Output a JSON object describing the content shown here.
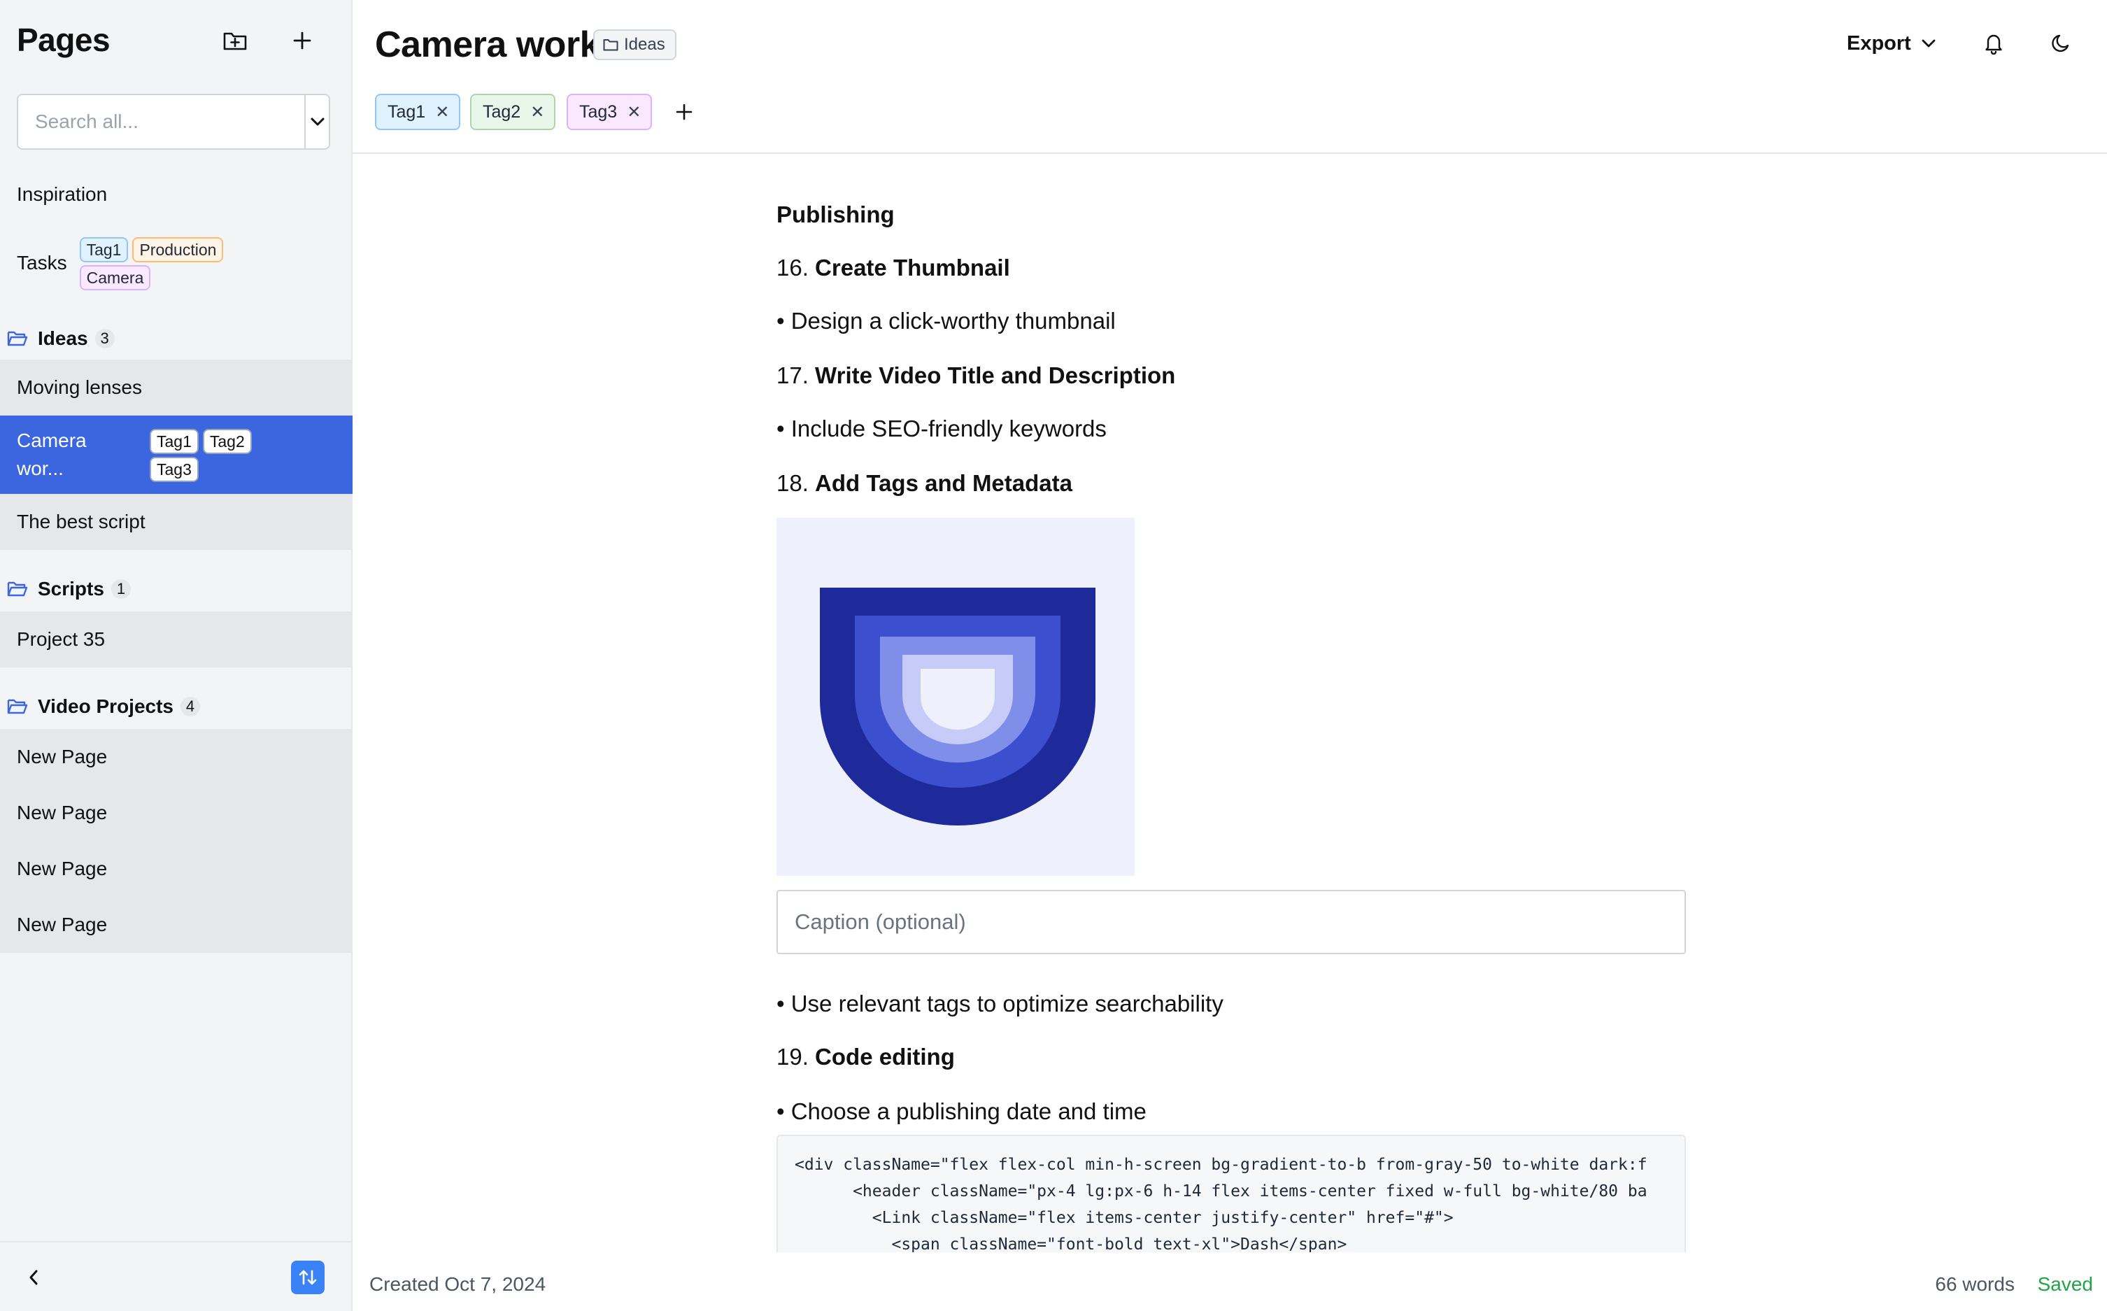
{
  "sidebar": {
    "title": "Pages",
    "search_placeholder": "Search all...",
    "top_items": [
      {
        "label": "Inspiration"
      },
      {
        "label": "Tasks",
        "tags": [
          "Tag1",
          "Production",
          "Camera"
        ]
      }
    ],
    "folders": [
      {
        "name": "Ideas",
        "count": "3",
        "pages": [
          {
            "label": "Moving lenses"
          },
          {
            "label_line1": "Camera",
            "label_line2": "wor...",
            "tags": [
              "Tag1",
              "Tag2",
              "Tag3"
            ],
            "active": true
          },
          {
            "label": "The best script"
          }
        ]
      },
      {
        "name": "Scripts",
        "count": "1",
        "pages": [
          {
            "label": "Project 35"
          }
        ]
      },
      {
        "name": "Video Projects",
        "count": "4",
        "pages": [
          {
            "label": "New Page"
          },
          {
            "label": "New Page"
          },
          {
            "label": "New Page"
          },
          {
            "label": "New Page"
          }
        ]
      }
    ]
  },
  "header": {
    "title": "Camera work",
    "folder_chip": "Ideas",
    "export_label": "Export",
    "tags": [
      {
        "label": "Tag1",
        "color": "#e0f2fe"
      },
      {
        "label": "Tag2",
        "color": "#e8f7ea"
      },
      {
        "label": "Tag3",
        "color": "#fae8ff"
      }
    ],
    "tag_remove_glyph": "✕"
  },
  "content": {
    "section_heading": "Publishing",
    "items": [
      {
        "num": "16.",
        "title": "Create Thumbnail"
      },
      {
        "bullet": "• Design a click-worthy thumbnail"
      },
      {
        "num": "17.",
        "title": "Write Video Title and Description"
      },
      {
        "bullet": "• Include SEO-friendly keywords"
      },
      {
        "num": "18.",
        "title": "Add Tags and Metadata"
      },
      {
        "bullet": "• Use relevant tags to optimize searchability"
      },
      {
        "num": "19.",
        "title": "Code editing"
      },
      {
        "bullet": "• Choose a publishing date and time"
      }
    ],
    "caption_placeholder": "Caption (optional)",
    "image_colors": [
      "#1e2a9a",
      "#3c4fcf",
      "#7f8fe9",
      "#c6ccf7",
      "#eef0fc"
    ],
    "code_lines": [
      "<div className=\"flex flex-col min-h-screen bg-gradient-to-b from-gray-50 to-white dark:f",
      "      <header className=\"px-4 lg:px-6 h-14 flex items-center fixed w-full bg-white/80 ba",
      "        <Link className=\"flex items-center justify-center\" href=\"#\">",
      "          <span className=\"font-bold text-xl\">Dash</span>"
    ]
  },
  "status": {
    "created": "Created Oct 7, 2024",
    "words": "66 words",
    "saved": "Saved"
  },
  "colors": {
    "accent": "#3b66e0",
    "saved_green": "#22a447"
  }
}
